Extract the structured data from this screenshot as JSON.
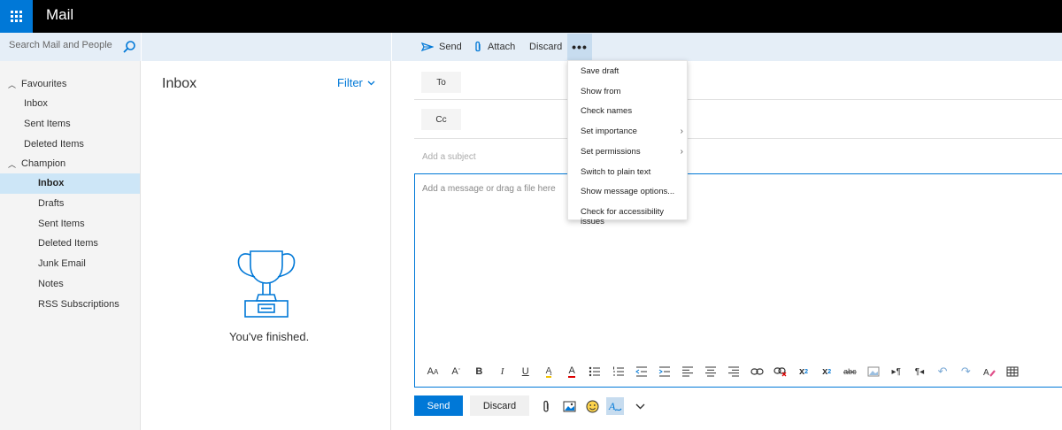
{
  "app": {
    "title": "Mail"
  },
  "search": {
    "placeholder": "Search Mail and People"
  },
  "nav": {
    "favourites_label": "Favourites",
    "favourites": [
      "Inbox",
      "Sent Items",
      "Deleted Items"
    ],
    "account_label": "Champion",
    "account_items": [
      "Inbox",
      "Drafts",
      "Sent Items",
      "Deleted Items",
      "Junk Email",
      "Notes",
      "RSS Subscriptions"
    ],
    "selected": "Inbox"
  },
  "list": {
    "title": "Inbox",
    "filter_label": "Filter",
    "empty_message": "You've finished."
  },
  "toolbar": {
    "send_label": "Send",
    "attach_label": "Attach",
    "discard_label": "Discard",
    "more_label": "•••"
  },
  "compose": {
    "to_label": "To",
    "cc_label": "Cc",
    "subject_placeholder": "Add a subject",
    "body_placeholder": "Add a message or drag a file here",
    "send_label": "Send",
    "discard_label": "Discard"
  },
  "more_menu": {
    "items": [
      {
        "label": "Save draft",
        "submenu": false
      },
      {
        "label": "Show from",
        "submenu": false
      },
      {
        "label": "Check names",
        "submenu": false
      },
      {
        "label": "Set importance",
        "submenu": true
      },
      {
        "label": "Set permissions",
        "submenu": true
      },
      {
        "label": "Switch to plain text",
        "submenu": false
      },
      {
        "label": "Show message options...",
        "submenu": false
      },
      {
        "label": "Check for accessibility issues",
        "submenu": false
      }
    ]
  },
  "format_toolbar": [
    "font-size-icon",
    "shrink-font-icon",
    "bold-icon",
    "italic-icon",
    "underline-icon",
    "highlight-icon",
    "font-color-icon",
    "bullets-icon",
    "numbering-icon",
    "decrease-indent-icon",
    "increase-indent-icon",
    "align-left-icon",
    "align-center-icon",
    "align-right-icon",
    "insert-link-icon",
    "remove-link-icon",
    "superscript-icon",
    "subscript-icon",
    "strikethrough-icon",
    "insert-image-icon",
    "ltr-icon",
    "rtl-icon",
    "undo-icon",
    "redo-icon",
    "clear-format-icon",
    "insert-table-icon"
  ],
  "colors": {
    "accent": "#0078d7",
    "topbar": "#000000",
    "toolbar_bg": "#e5eef7",
    "selected_nav": "#cde6f7"
  }
}
